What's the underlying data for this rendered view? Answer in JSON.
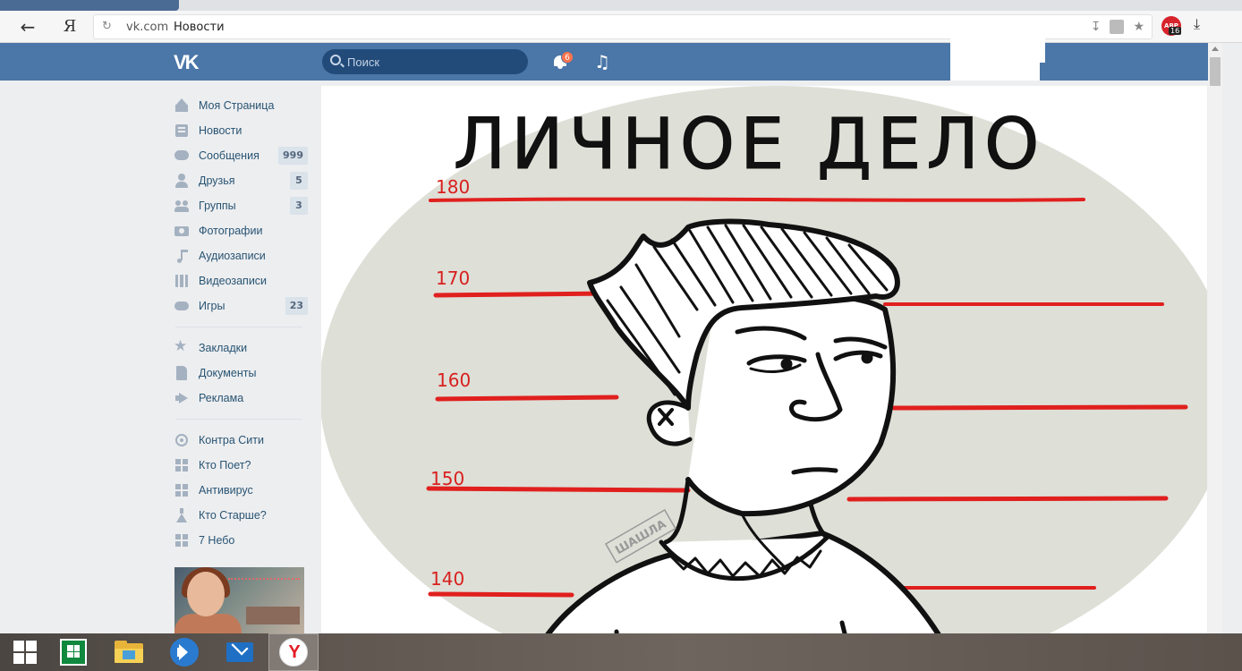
{
  "browser": {
    "tab_title": "Новости",
    "back_icon": "arrow-left-icon",
    "yandex_button_label": "Я",
    "address": {
      "domain": "vk.com",
      "page_title": "Новости"
    },
    "extension_badge": "16",
    "extension_label": "ABP"
  },
  "vk_header": {
    "logo_text": "VK",
    "search_placeholder": "Поиск",
    "notifications_count": "6"
  },
  "sidebar": {
    "main": [
      {
        "label": "Моя Страница",
        "icon": "home-icon",
        "count": ""
      },
      {
        "label": "Новости",
        "icon": "news-icon",
        "count": ""
      },
      {
        "label": "Сообщения",
        "icon": "message-icon",
        "count": "999"
      },
      {
        "label": "Друзья",
        "icon": "friends-icon",
        "count": "5"
      },
      {
        "label": "Группы",
        "icon": "groups-icon",
        "count": "3"
      },
      {
        "label": "Фотографии",
        "icon": "camera-icon",
        "count": ""
      },
      {
        "label": "Аудиозаписи",
        "icon": "music-note-icon",
        "count": ""
      },
      {
        "label": "Видеозаписи",
        "icon": "film-icon",
        "count": ""
      },
      {
        "label": "Игры",
        "icon": "gamepad-icon",
        "count": "23"
      }
    ],
    "secondary": [
      {
        "label": "Закладки",
        "icon": "star-icon"
      },
      {
        "label": "Документы",
        "icon": "document-icon"
      },
      {
        "label": "Реклама",
        "icon": "megaphone-icon"
      }
    ],
    "apps": [
      {
        "label": "Контра Сити",
        "icon": "crosshair-icon"
      },
      {
        "label": "Кто Поет?",
        "icon": "app-grid-icon"
      },
      {
        "label": "Антивирус",
        "icon": "app-grid-icon"
      },
      {
        "label": "Кто Старше?",
        "icon": "flask-icon"
      },
      {
        "label": "7 Небо",
        "icon": "app-grid-icon"
      }
    ]
  },
  "content": {
    "illustration": {
      "title": "ЛИЧНОЕ ДЕЛО",
      "height_marks": [
        "180",
        "170",
        "160",
        "150",
        "140"
      ],
      "watermark_text": "ШАШЛА"
    }
  },
  "taskbar": {
    "items": [
      {
        "name": "start-button",
        "icon": "windows-logo-icon"
      },
      {
        "name": "store-button",
        "icon": "store-icon"
      },
      {
        "name": "file-explorer-button",
        "icon": "folder-icon"
      },
      {
        "name": "media-player-button",
        "icon": "speaker-icon"
      },
      {
        "name": "mail-button",
        "icon": "mail-icon"
      },
      {
        "name": "yandex-browser-button",
        "icon": "yandex-icon",
        "active": true
      }
    ],
    "yandex_glyph": "Y"
  },
  "colors": {
    "vk_blue": "#4a76a8",
    "sidebar_bg": "#edeef0",
    "link": "#285473",
    "count_badge_bg": "#dae2ea",
    "notification_badge": "#ff734c",
    "height_line_red": "#e0201e",
    "illustration_bg": "#dedfd7"
  }
}
